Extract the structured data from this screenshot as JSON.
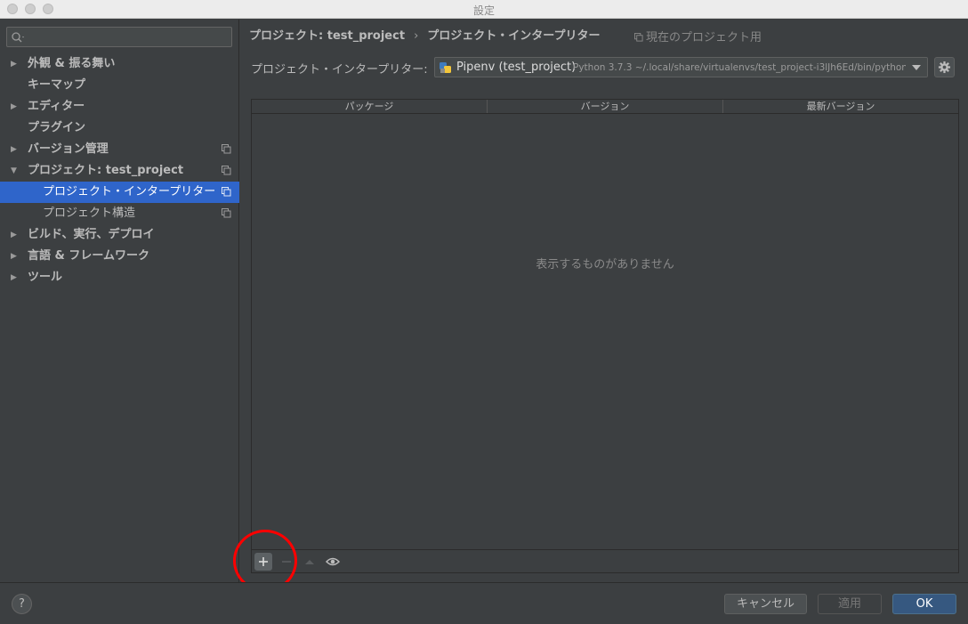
{
  "window": {
    "title": "設定"
  },
  "sidebar": {
    "items": [
      {
        "label": "外観 & 振る舞い",
        "expand": "▶"
      },
      {
        "label": "キーマップ"
      },
      {
        "label": "エディター",
        "expand": "▶"
      },
      {
        "label": "プラグイン"
      },
      {
        "label": "バージョン管理",
        "expand": "▶"
      },
      {
        "label": "プロジェクト: test_project",
        "expand": "▼"
      },
      {
        "label": "プロジェクト・インタープリター"
      },
      {
        "label": "プロジェクト構造"
      },
      {
        "label": "ビルド、実行、デプロイ",
        "expand": "▶"
      },
      {
        "label": "言語 & フレームワーク",
        "expand": "▶"
      },
      {
        "label": "ツール",
        "expand": "▶"
      }
    ]
  },
  "breadcrumb": {
    "parent": "プロジェクト: test_project",
    "separator": "›",
    "current": "プロジェクト・インタープリター"
  },
  "scope_label": "現在のプロジェクト用",
  "interpreter": {
    "label": "プロジェクト・インタープリター:",
    "name": "Pipenv (test_project)",
    "path": "Python 3.7.3 ~/.local/share/virtualenvs/test_project-i3lJh6Ed/bin/python"
  },
  "table": {
    "columns": [
      "パッケージ",
      "バージョン",
      "最新バージョン"
    ],
    "empty_text": "表示するものがありません"
  },
  "footer": {
    "help_label": "?",
    "cancel_label": "キャンセル",
    "apply_label": "適用",
    "ok_label": "OK"
  },
  "colors": {
    "background": "#3c3f41",
    "selection": "#2f65ca",
    "ok_button": "#365880",
    "annotation_circle": "#ff0000"
  }
}
